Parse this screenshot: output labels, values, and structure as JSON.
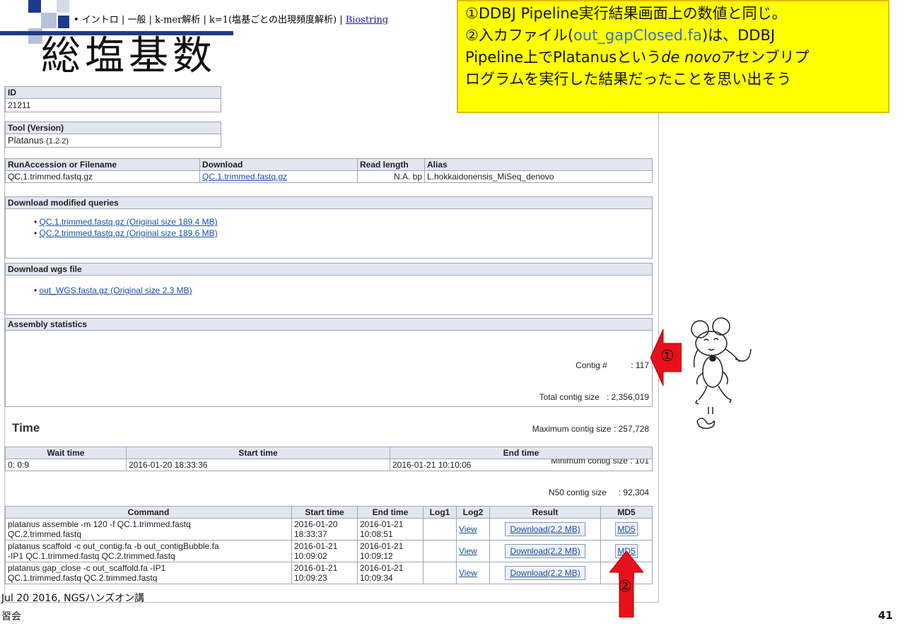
{
  "breadcrumb": {
    "text": "• イントロ | 一般 | k-mer解析 | k=1(塩基ごとの出現頻度解析) | ",
    "link": "Biostring"
  },
  "slide": {
    "title": "総塩基数",
    "footer_left_1": "Jul 20 2016, NGSハンズオン講",
    "footer_left_2": "習会",
    "page_number": "41"
  },
  "callout": {
    "line1": "①DDBJ Pipeline実行結果画面上の数値と同じ。",
    "line2_a": "②入カファイル(",
    "line2_file": "out_gapClosed.fa",
    "line2_b": ")は、DDBJ",
    "line3_a": "Pipeline上でPlatanusという",
    "line3_italic": "de novo",
    "line3_b": "アセンブリプ",
    "line4": "ログラムを実行した結果だったことを思い出そう"
  },
  "job": {
    "id_label": "ID",
    "id_value": "21211",
    "tool_label": "Tool (Version)",
    "tool_name": "Platanus",
    "tool_version": "(1.2.2)"
  },
  "run_table": {
    "headers": [
      "RunAccession or Filename",
      "Download",
      "Read length",
      "Alias"
    ],
    "row": [
      "QC.1.trimmed.fastq.gz",
      "QC.1.trimmed.fastq.gz",
      "N.A. bp",
      "L.hokkaidonensis_MiSeq_denovo"
    ]
  },
  "modified_queries": {
    "header": "Download modified queries",
    "items": [
      "QC.1.trimmed.fastq.gz (Original size 189.4 MB)",
      "QC.2.trimmed.fastq.gz (Original size 189.6 MB)"
    ]
  },
  "wgs": {
    "header": "Download wgs file",
    "item": "out_WGS.fasta.gz (Original size 2.3 MB)"
  },
  "assembly": {
    "header": "Assembly statistics",
    "lines": [
      "Contig #          : 117",
      "Total contig size   : 2,356,019",
      "Maximum contig size : 257,728",
      "Minimum contig size : 101",
      "N50 contig size     : 92,304"
    ]
  },
  "time": {
    "heading": "Time",
    "headers": [
      "Wait time",
      "Start time",
      "End time"
    ],
    "row": [
      "0: 0:9",
      "2016-01-20 18:33:36",
      "2016-01-21 10:10:06"
    ]
  },
  "commands": {
    "headers": [
      "Command",
      "Start time",
      "End time",
      "Log1",
      "Log2",
      "Result",
      "MD5"
    ],
    "rows": [
      {
        "cmd1": "platanus assemble -m 120 -f QC.1.trimmed.fastq",
        "cmd2": "QC.2.trimmed.fastq",
        "start1": "2016-01-20",
        "start2": "18:33:37",
        "end1": "2016-01-21",
        "end2": "10:08:51",
        "log2": "View",
        "result": "Download(2.2 MB)",
        "md5": "MD5"
      },
      {
        "cmd1": "platanus scaffold -c out_contig.fa -b out_contigBubble.fa",
        "cmd2": "-IP1 QC.1.trimmed.fastq QC.2.trimmed.fastq",
        "start1": "2016-01-21",
        "start2": "10:09:02",
        "end1": "2016-01-21",
        "end2": "10:09:12",
        "log2": "View",
        "result": "Download(2.2 MB)",
        "md5": "MD5"
      },
      {
        "cmd1": "platanus gap_close -c out_scaffold.fa -IP1",
        "cmd2": "QC.1.trimmed.fastq QC.2.trimmed.fastq",
        "start1": "2016-01-21",
        "start2": "10:09:23",
        "end1": "2016-01-21",
        "end2": "10:09:34",
        "log2": "View",
        "result": "Download(2.2 MB)",
        "md5": "D5"
      }
    ]
  },
  "markers": {
    "one": "①",
    "two": "②"
  },
  "colors": {
    "callout_bg": "#ffff00",
    "header_bg": "#e2e6ef",
    "arrow_red": "#e8101a",
    "title_bar": "#1e3a8c"
  }
}
